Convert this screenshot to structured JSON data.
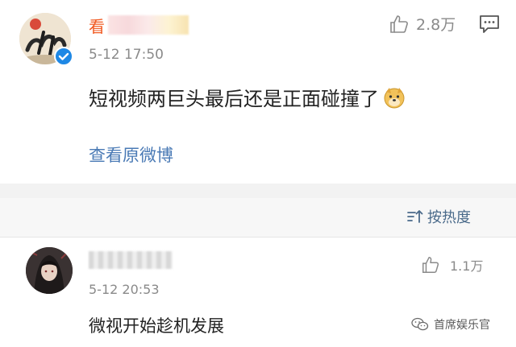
{
  "post": {
    "author_visible_char": "看",
    "time": "5-12 17:50",
    "like_count": "2.8万",
    "text": "短视频两巨头最后还是正面碰撞了",
    "view_original": "查看原微博"
  },
  "sort": {
    "label": "按热度"
  },
  "reply": {
    "time": "5-12 20:53",
    "like_count": "1.1万",
    "text": "微视开始趁机发展"
  },
  "watermark": {
    "text": "首席娱乐官"
  },
  "icons": {
    "like": "thumbs-up-icon",
    "comment": "comment-icon",
    "sort": "sort-icon",
    "verified": "verified-badge-icon",
    "emoji": "doge-emoji-icon",
    "wechat": "wechat-icon"
  },
  "colors": {
    "author_name": "#f15a22",
    "link": "#4a7ab5",
    "verified": "#1e88e5",
    "meta_gray": "#8a8a8a"
  }
}
